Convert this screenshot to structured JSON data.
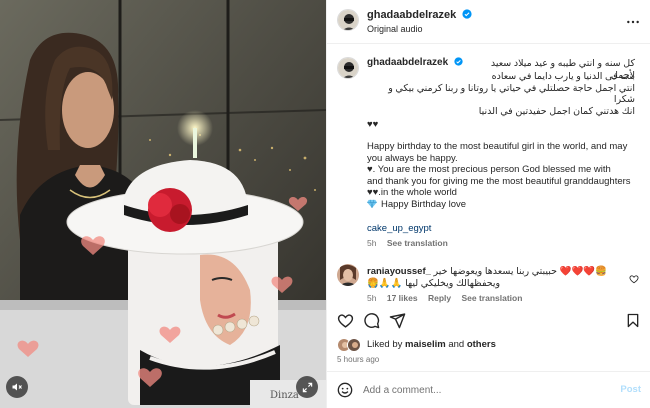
{
  "post": {
    "author": "ghadaabdelrazek",
    "audio": "Original audio",
    "caption": {
      "arabic_lines": [
        "كل سنه و انتي طيبه و عيد ميلاد سعيد لأجمل",
        "بنت فى الدنيا و يارب دايما في سعاده",
        "انتي اجمل حاجة حصلتلي في حياتي يا روتانا و ربنا كرمني بيكي و شكرا",
        "انك هدتني كمان اجمل حفيدتين في الدنيا"
      ],
      "hearts": "♥♥",
      "english_lines": [
        "Happy birthday to the most beautiful girl in the world, and may",
        "you always be happy.",
        "♥. You are the most precious person God blessed me with",
        "and thank you for giving me the most beautiful granddaughters",
        "♥♥.in the whole world"
      ],
      "love_line": "Happy Birthday love",
      "tag": "cake_up_egypt",
      "time_ago": "5h",
      "see_translation": "See translation"
    },
    "comment": {
      "user": "raniayoussef_",
      "line1": "حبيبتي ربنا يسعدها ويعوضها خير ❤️❤️❤️🍔🍔",
      "line2": "ويحفظهالك ويخليكي ليها 🙏🙏🙏",
      "time_ago": "5h",
      "likes": "17 likes",
      "reply": "Reply",
      "see_translation": "See translation"
    },
    "liked_by": {
      "prefix": "Liked by",
      "user": "maiselim",
      "and": "and",
      "others": "others"
    },
    "timestamp": "5 hours ago",
    "add_comment_placeholder": "Add a comment...",
    "post_label": "Post"
  },
  "icons": {
    "more": "more-horizontal-icon",
    "like": "heart-icon",
    "comment": "comment-icon",
    "share": "share-icon",
    "save": "bookmark-icon",
    "emoji": "emoji-icon",
    "mute": "mute-icon",
    "expand": "expand-icon",
    "verified": "verified-badge-icon"
  },
  "colors": {
    "verified": "#0095f6",
    "link": "#00376b",
    "muted": "#737373",
    "post_disabled": "#b2dffc",
    "text": "#262626"
  }
}
